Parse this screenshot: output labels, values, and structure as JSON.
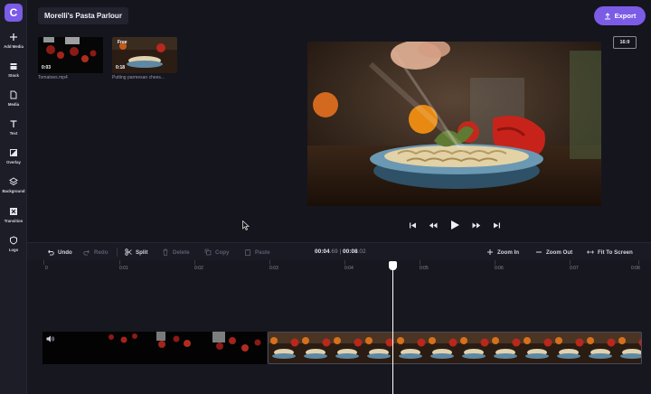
{
  "app": {
    "logo_letter": "C"
  },
  "project": {
    "title": "Morelli's Pasta Parlour"
  },
  "header": {
    "export_label": "Export"
  },
  "sidebar": {
    "items": [
      {
        "label": "Add Media",
        "icon": "plus-icon"
      },
      {
        "label": "Stock",
        "icon": "stock-icon"
      },
      {
        "label": "Media",
        "icon": "media-file-icon"
      },
      {
        "label": "Text",
        "icon": "text-icon"
      },
      {
        "label": "Overlay",
        "icon": "overlay-icon"
      },
      {
        "label": "Background",
        "icon": "layers-icon"
      },
      {
        "label": "Transition",
        "icon": "transition-icon"
      },
      {
        "label": "Logo",
        "icon": "shield-icon"
      }
    ]
  },
  "media": {
    "clips": [
      {
        "duration": "0:03",
        "name": "Tomatoes.mp4",
        "badge": ""
      },
      {
        "duration": "0:18",
        "name": "Putting parmesan chees...",
        "badge": "Free"
      }
    ]
  },
  "preview": {
    "aspect_ratio": "16:9"
  },
  "toolbar": {
    "undo": "Undo",
    "redo": "Redo",
    "split": "Split",
    "delete": "Delete",
    "copy": "Copy",
    "paste": "Paste",
    "current_time_main": "00:04",
    "current_time_frac": ".69",
    "total_time_main": "00:08",
    "total_time_frac": ".02",
    "time_separator": " | ",
    "zoom_in": "Zoom In",
    "zoom_out": "Zoom Out",
    "fit": "Fit To Screen"
  },
  "timeline": {
    "ruler_labels": [
      "0",
      "0:01",
      "0:02",
      "0:03",
      "0:04",
      "0:05",
      "0:06",
      "0:07",
      "0:08"
    ],
    "playhead_time": "00:04.69"
  },
  "colors": {
    "accent": "#7b5ce6",
    "background": "#15151e",
    "panel": "#1d1d28"
  }
}
